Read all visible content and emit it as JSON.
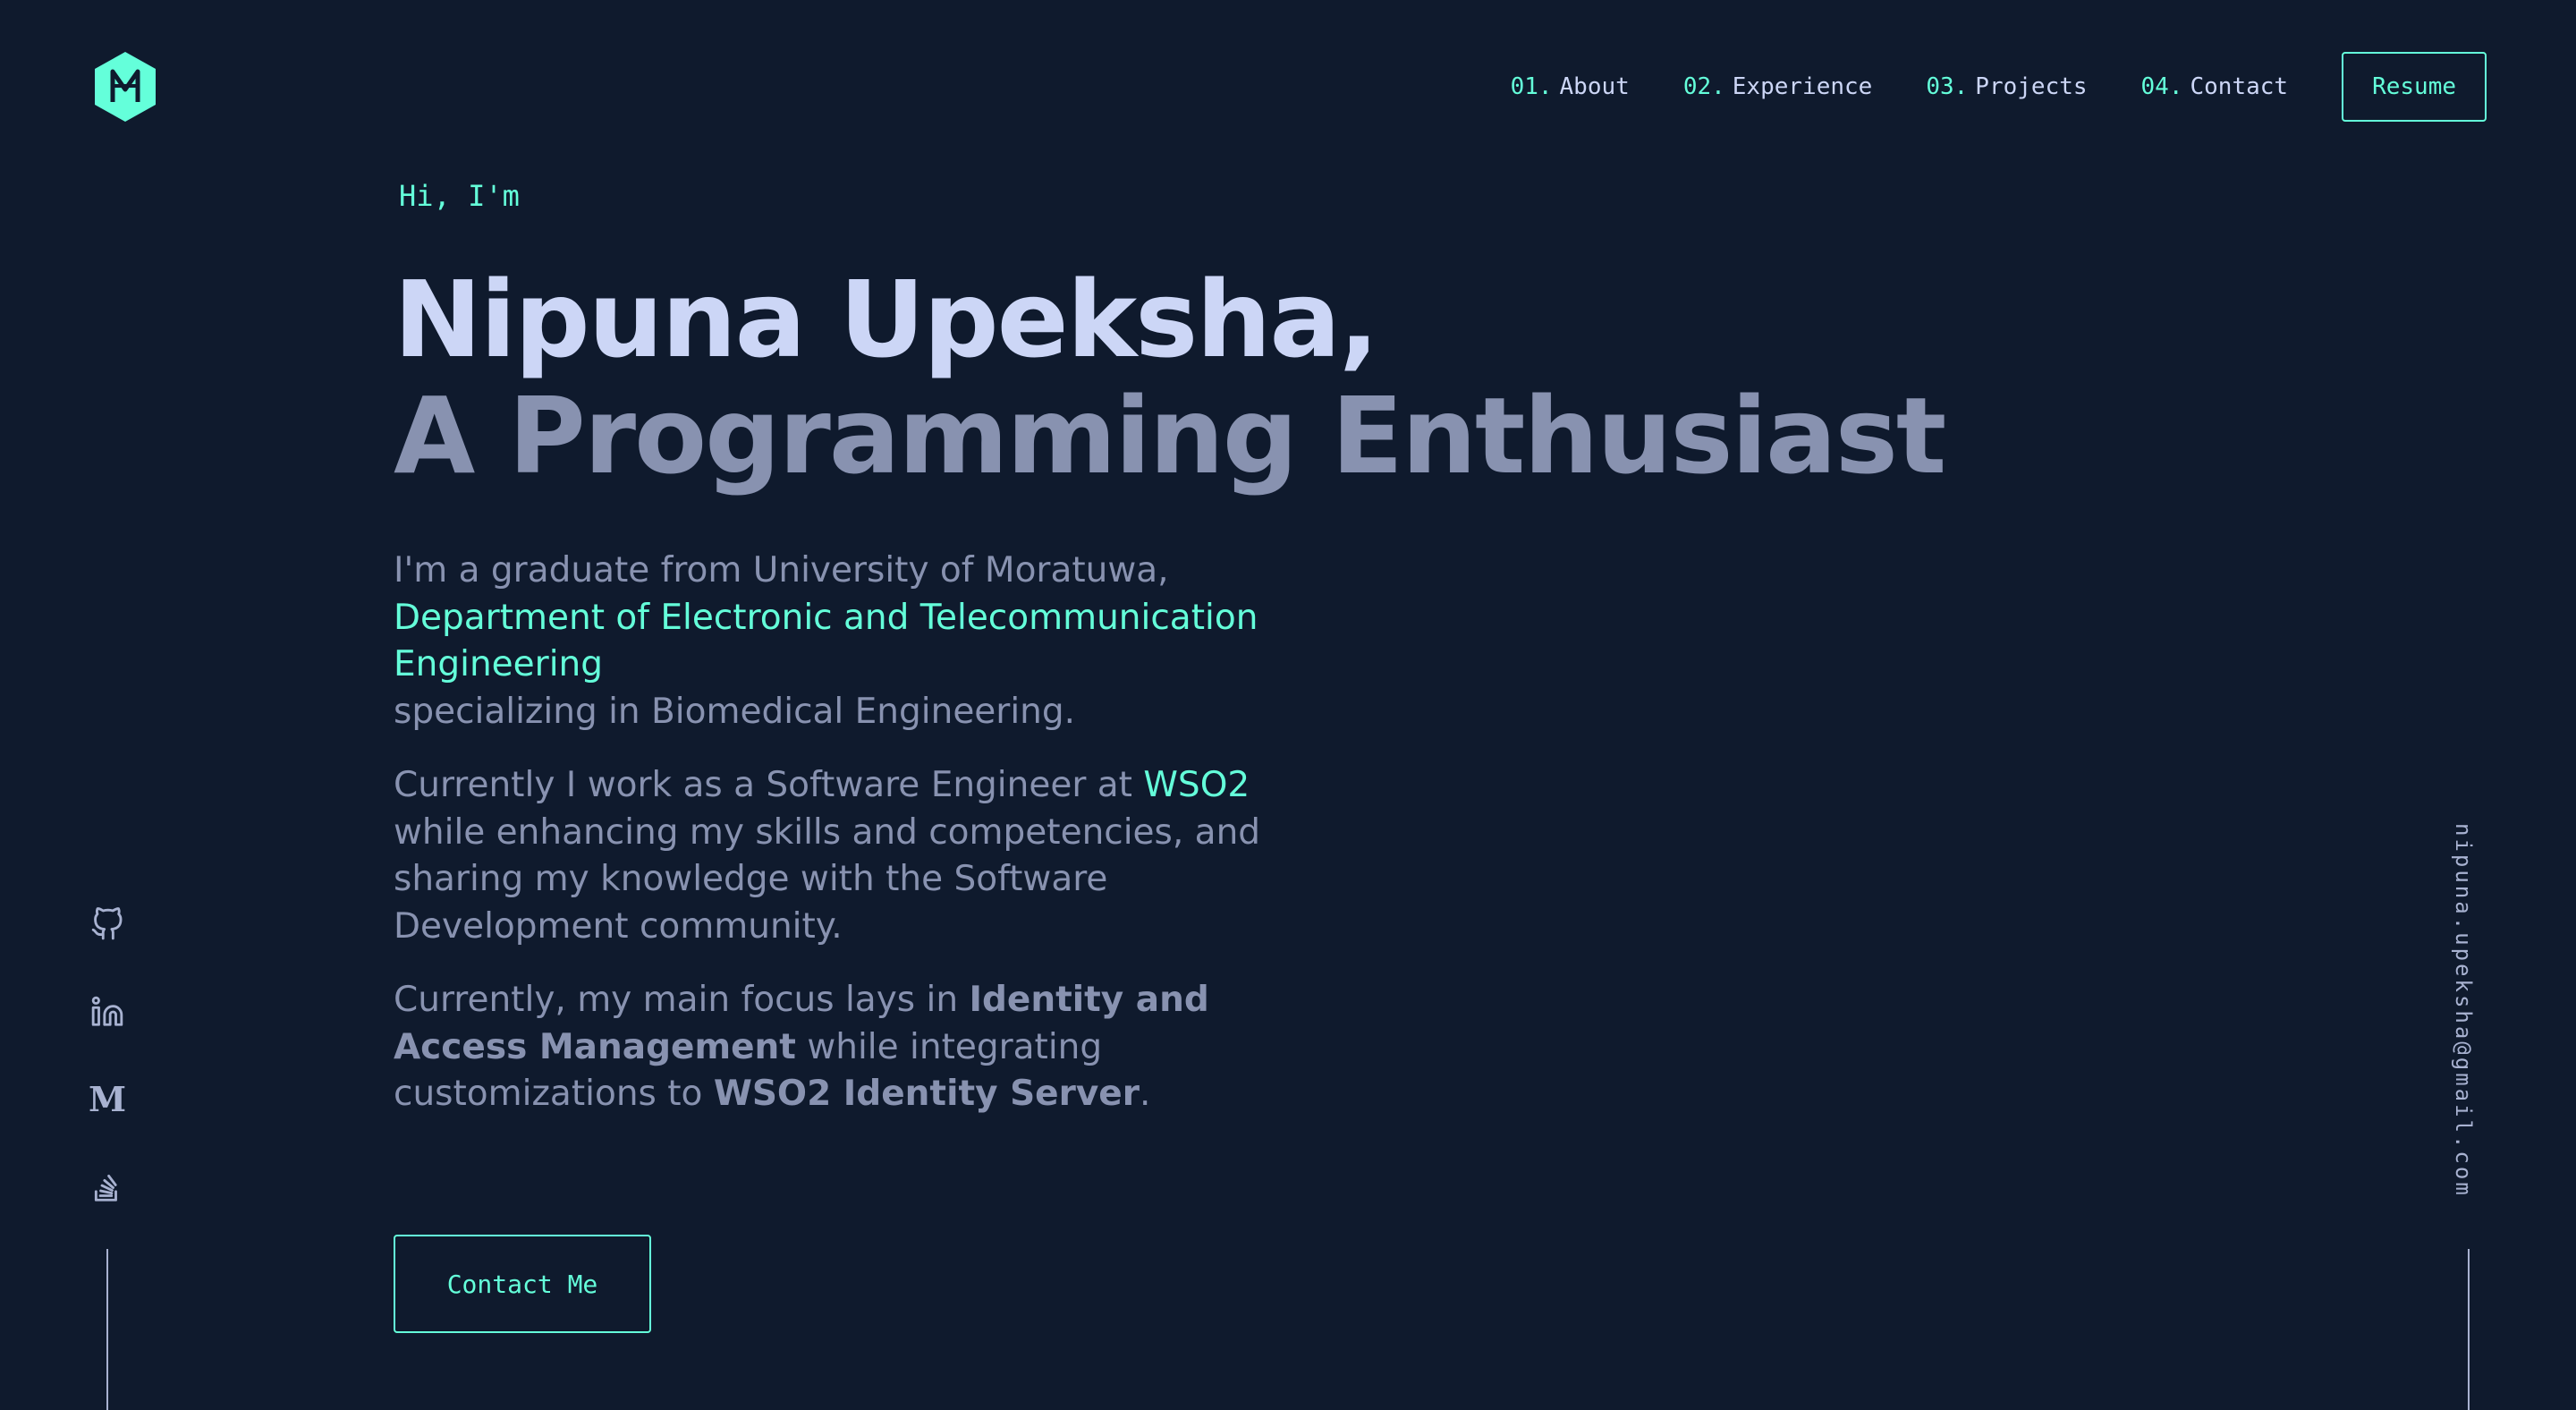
{
  "colors": {
    "background": "#0f1a2d",
    "accent": "#64ffda",
    "heading": "#ccd6f6",
    "text": "#8892b0"
  },
  "logo": {
    "icon": "hexagon-logo-icon"
  },
  "nav": {
    "items": [
      {
        "num": "01.",
        "label": "About"
      },
      {
        "num": "02.",
        "label": "Experience"
      },
      {
        "num": "03.",
        "label": "Projects"
      },
      {
        "num": "04.",
        "label": "Contact"
      }
    ],
    "resume_label": "Resume"
  },
  "hero": {
    "greeting": "Hi, I'm",
    "name": "Nipuna Upeksha,",
    "tagline": "A Programming Enthusiast"
  },
  "bio": {
    "p1_a": "I'm a graduate from University of Moratuwa,",
    "p1_link": "Department of Electronic and Telecommunication Engineering",
    "p1_b": "specializing in Biomedical Engineering.",
    "p2_a": "Currently I work as a Software Engineer at ",
    "p2_link": "WSO2",
    "p2_b": "while enhancing my skills and competencies, and sharing my knowledge with the Software Development community.",
    "p3_a": "Currently, my main focus lays in ",
    "p3_strong1": "Identity and Access Management",
    "p3_b": " while integrating customizations to ",
    "p3_strong2": "WSO2 Identity Server",
    "p3_c": "."
  },
  "contact_button": "Contact Me",
  "social": {
    "items": [
      {
        "icon": "github-icon"
      },
      {
        "icon": "linkedin-icon"
      },
      {
        "icon": "medium-icon",
        "glyph": "M"
      },
      {
        "icon": "stackoverflow-icon"
      }
    ]
  },
  "email": "nipuna.upeksha@gmail.com"
}
